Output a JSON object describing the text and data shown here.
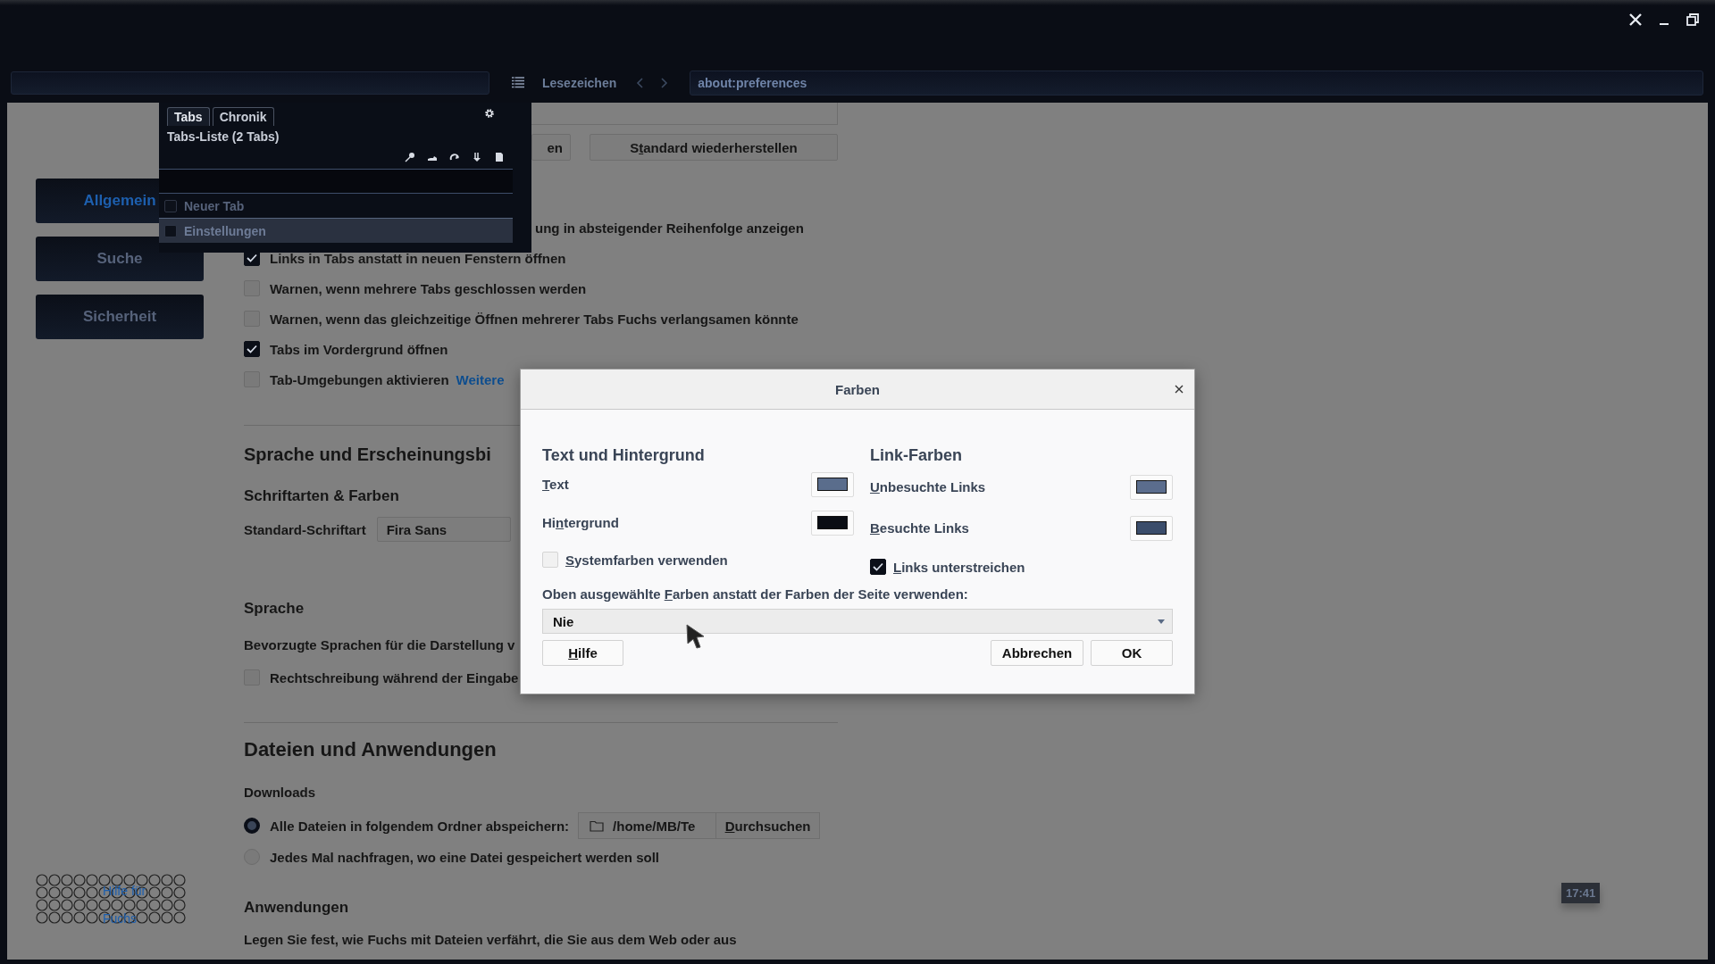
{
  "toolbar": {
    "bookmarks_label": "Lesezeichen",
    "url": "about:preferences"
  },
  "tab_popup": {
    "tabs": [
      {
        "label": "Tabs",
        "selected": true
      },
      {
        "label": "Chronik",
        "selected": false
      }
    ],
    "title": "Tabs-Liste (2 Tabs)",
    "items": [
      {
        "label": "Neuer Tab",
        "selected": false,
        "checked": false
      },
      {
        "label": "Einstellungen",
        "selected": true,
        "checked": false
      }
    ]
  },
  "sidebar": {
    "items": [
      {
        "label": "Allgemein",
        "selected": true
      },
      {
        "label": "Suche",
        "selected": false
      },
      {
        "label": "Sicherheit",
        "selected": false
      }
    ]
  },
  "content": {
    "top_buttons": [
      {
        "label": "en"
      },
      {
        "label": {
          "before": "S",
          "key": "t",
          "after": "andard wiederherstellen"
        }
      }
    ],
    "tab_options": [
      {
        "kind": "covered",
        "label": "ung in absteigender Reihenfolge anzeigen"
      },
      {
        "kind": "checkbox",
        "label": "Links in Tabs anstatt in neuen Fenstern öffnen",
        "checked": true
      },
      {
        "kind": "checkbox",
        "label": "Warnen, wenn mehrere Tabs geschlossen werden",
        "checked": false
      },
      {
        "kind": "checkbox",
        "label": "Warnen, wenn das gleichzeitige Öffnen mehrerer Tabs Fuchs verlangsamen könnte",
        "checked": false
      },
      {
        "kind": "checkbox",
        "label": "Tabs im Vordergrund öffnen",
        "checked": true
      },
      {
        "kind": "checkbox",
        "label": "Tab-Umgebungen aktivieren",
        "checked": false,
        "link": "Weitere"
      }
    ],
    "language_heading": "Sprache und Erscheinungsbi",
    "fonts_heading": "Schriftarten & Farben",
    "default_font": {
      "label": "Standard-Schriftart",
      "value": "Fira Sans"
    },
    "language_subheading": "Sprache",
    "language_text": "Bevorzugte Sprachen für die Darstellung v",
    "spellcheck": {
      "label": "Rechtschreibung während der Eingabe",
      "checked": false
    },
    "files_heading": "Dateien und Anwendungen",
    "downloads_heading": "Downloads",
    "download_options": [
      {
        "label": "Alle Dateien in folgendem Ordner abspeichern:",
        "selected": true
      },
      {
        "label": "Jedes Mal nachfragen, wo eine Datei gespeichert werden soll",
        "selected": false
      }
    ],
    "download_folder": "/home/MB/Te",
    "browse_button": {
      "key": "D",
      "after": "urchsuchen"
    },
    "applications_heading": "Anwendungen",
    "applications_text": "Legen Sie fest, wie Fuchs mit Dateien verfährt, die Sie aus dem Web oder aus"
  },
  "help_link": {
    "lines": [
      "Hilfe für",
      "Fuchs"
    ]
  },
  "clock": "17:41",
  "dialog": {
    "title": "Farben",
    "text_section": {
      "heading": "Text und Hintergrund",
      "colors": [
        {
          "label": {
            "key": "T",
            "after": "ext"
          },
          "color": "#5a6d8c"
        },
        {
          "label": {
            "before": "Hi",
            "key": "n",
            "after": "tergrund"
          },
          "color": "#0a0d14"
        }
      ],
      "option": {
        "label": {
          "key": "S",
          "after": "ystemfarben verwenden"
        },
        "checked": false
      }
    },
    "link_section": {
      "heading": "Link-Farben",
      "colors": [
        {
          "label": {
            "key": "U",
            "after": "nbesuchte Links"
          },
          "color": "#5b6d8d"
        },
        {
          "label": {
            "key": "B",
            "after": "esuchte Links"
          },
          "color": "#3b4d6b"
        }
      ],
      "option": {
        "label": {
          "key": "L",
          "after": "inks unterstreichen"
        },
        "checked": true
      }
    },
    "override_label": {
      "before": "Oben ausgewählte ",
      "key": "F",
      "after": "arben anstatt der Farben der Seite verwenden:"
    },
    "override_value": "Nie",
    "buttons": [
      {
        "kind": "help",
        "label": {
          "key": "H",
          "after": "ilfe"
        }
      },
      {
        "kind": "cancel",
        "label": "Abbrechen"
      },
      {
        "kind": "ok",
        "label": "OK"
      }
    ]
  }
}
